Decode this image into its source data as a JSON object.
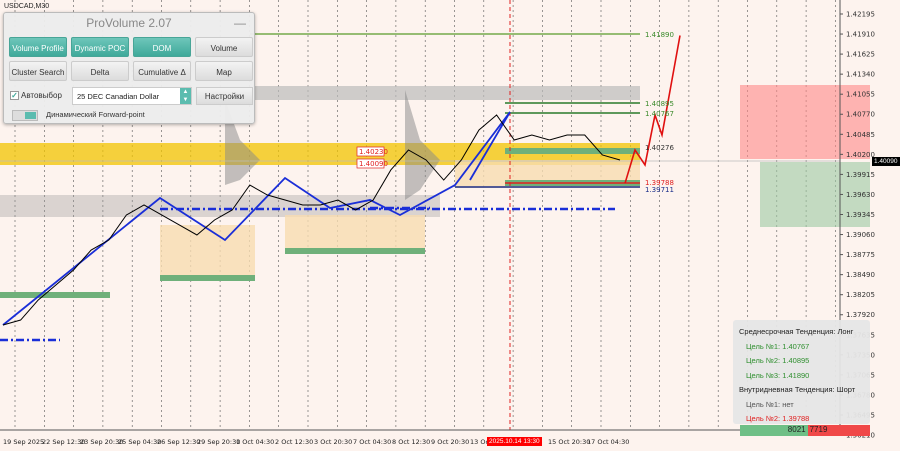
{
  "symbol": "USDCAD,M30",
  "panel": {
    "title": "ProVolume 2.07",
    "minimize": "—",
    "buttons": [
      {
        "label": "Volume Profile",
        "hotkey": "V",
        "active": true
      },
      {
        "label": "Dynamic POC",
        "hotkey": "P",
        "active": true
      },
      {
        "label": "DOM",
        "hotkey": "D",
        "active": true
      },
      {
        "label": "Volume",
        "hotkey": "",
        "active": false
      },
      {
        "label": "Cluster Search",
        "hotkey": "B N",
        "active": false
      },
      {
        "label": "Delta",
        "hotkey": "",
        "active": false
      },
      {
        "label": "Cumulative Δ",
        "hotkey": "M",
        "active": false
      },
      {
        "label": "Map",
        "hotkey": "J",
        "active": false
      }
    ],
    "autoselect_label": "Автовыбор",
    "autoselect_checked": true,
    "instrument": "25 DEC Canadian Dollar",
    "settings_label": "Настройки",
    "forward_label": "Динамический Forward-point"
  },
  "price_axis": [
    "1.42195",
    "1.41910",
    "1.41625",
    "1.41340",
    "1.41055",
    "1.40770",
    "1.40485",
    "1.40200",
    "1.39915",
    "1.39630",
    "1.39345",
    "1.39060",
    "1.38775",
    "1.38490",
    "1.38205",
    "1.37920",
    "1.37635",
    "1.37350",
    "1.37065",
    "1.36780",
    "1.36495",
    "1.36210"
  ],
  "current_price": "1.40090",
  "date_axis": [
    "19 Sep 2025",
    "22 Sep 12:30",
    "23 Sep 20:30",
    "25 Sep 04:30",
    "26 Sep 12:30",
    "29 Sep 20:30",
    "1 Oct 04:30",
    "2 Oct 12:30",
    "3 Oct 20:30",
    "7 Oct 04:30",
    "8 Oct 12:30",
    "9 Oct 20:30",
    "13 Oct",
    "15 Oct 20:30",
    "17 Oct 04:30"
  ],
  "crosshair_time": "2025.10.14 13:30",
  "levels": {
    "target3": "1.41890",
    "target2": "1.40895",
    "target1": "1.40767",
    "pivot": "1.40276",
    "short_target": "1.39788",
    "support": "1.39711",
    "box_a": "1.40230",
    "box_b": "1.40090"
  },
  "price_series": [
    1.37774,
    1.37845,
    1.3813,
    1.38343,
    1.38556,
    1.3884,
    1.38982,
    1.39338,
    1.3948,
    1.39338,
    1.39196,
    1.39054,
    1.39267,
    1.39409,
    1.39764,
    1.39622,
    1.39551,
    1.3948,
    1.3948,
    1.39551,
    1.39409,
    1.39551,
    1.39978,
    1.40262,
    1.4012,
    1.39835,
    1.4012,
    1.40546,
    1.40759,
    1.40404,
    1.40475,
    1.40404,
    1.40475,
    1.40475,
    1.40191,
    1.4012
  ],
  "forecast": [
    1.39788,
    1.40262,
    1.4005,
    1.40759,
    1.40475,
    1.4189
  ],
  "info": {
    "mid_trend": "Среднесрочная Тенденция: Лонг",
    "mid_t1": "Цель №1: 1.40767",
    "mid_t2": "Цель №2: 1.40895",
    "mid_t3": "Цель №3: 1.41890",
    "intra_trend": "Внутридневная Тенденция: Шорт",
    "intra_t1": "Цель №1: нет",
    "intra_t2": "Цель №2: 1.39788"
  },
  "volume_bar": {
    "buy": "8021",
    "sell": "7719"
  },
  "colors": {
    "bg": "#fdf3ee",
    "accent": "#3fa99a",
    "price": "#000000",
    "zigzag": "#1a2ed8",
    "forecast": "#e01010",
    "buy": "#6fbf86",
    "sell": "#f04848"
  }
}
